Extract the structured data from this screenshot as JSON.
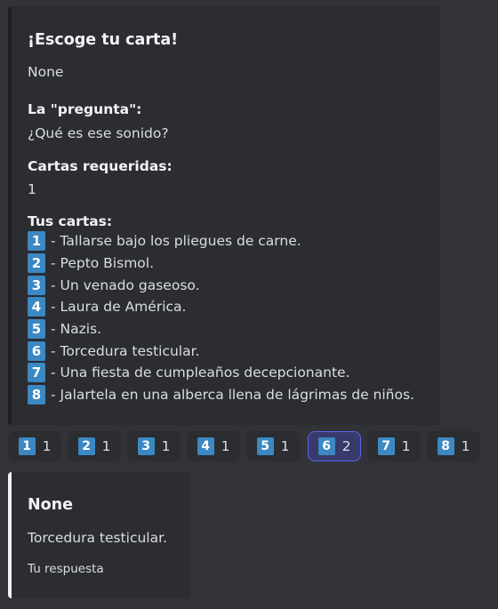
{
  "embed": {
    "title": "¡Escoge tu carta!",
    "description": "None",
    "fields": [
      {
        "name": "La \"pregunta\":",
        "value": "¿Qué es ese sonido?"
      },
      {
        "name": "Cartas requeridas:",
        "value": "1"
      },
      {
        "name": "Tus cartas:"
      }
    ],
    "cards": [
      {
        "number": "1",
        "text": "- Tallarse bajo los pliegues de carne."
      },
      {
        "number": "2",
        "text": "- Pepto Bismol."
      },
      {
        "number": "3",
        "text": "- Un venado gaseoso."
      },
      {
        "number": "4",
        "text": "- Laura de América."
      },
      {
        "number": "5",
        "text": "- Nazis."
      },
      {
        "number": "6",
        "text": "- Torcedura testicular."
      },
      {
        "number": "7",
        "text": "- Una fiesta de cumpleaños decepcionante."
      },
      {
        "number": "8",
        "text": "- Jalartela en una alberca llena de lágrimas de niños."
      }
    ]
  },
  "buttons": [
    {
      "emoji": "1",
      "count": "1"
    },
    {
      "emoji": "2",
      "count": "1"
    },
    {
      "emoji": "3",
      "count": "1"
    },
    {
      "emoji": "4",
      "count": "1"
    },
    {
      "emoji": "5",
      "count": "1"
    },
    {
      "emoji": "6",
      "count": "2",
      "selected": true
    },
    {
      "emoji": "7",
      "count": "1"
    },
    {
      "emoji": "8",
      "count": "1"
    }
  ],
  "answer_embed": {
    "title": "None",
    "description": "Torcedura testicular.",
    "footer": "Tu respuesta"
  },
  "colors": {
    "background": "#313338",
    "embed_background": "#2b2d31",
    "keycap_blue": "#3b88c3",
    "selected_border": "#5865f2"
  }
}
